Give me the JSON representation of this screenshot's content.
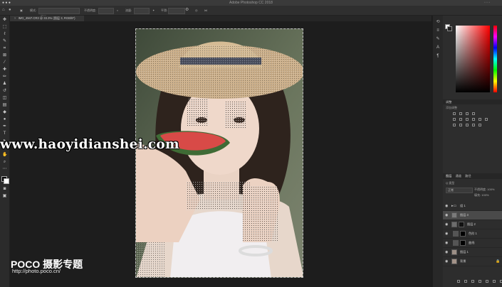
{
  "app": {
    "title": "Adobe Photoshop CC 2018",
    "document_tab": "IMG_4947.CR3 @ 33.3% (图层 3, RGB/8*)"
  },
  "options_bar": {
    "mode_label": "模式:",
    "mode_value": "正常",
    "opacity_label": "不透明度:",
    "opacity_value": "100%",
    "flow_label": "流量:",
    "flow_value": "100%",
    "smoothing_label": "平滑:"
  },
  "toolbar": {
    "tools": [
      "move-tool",
      "marquee-tool",
      "lasso-tool",
      "quick-select-tool",
      "crop-tool",
      "eyedropper-tool",
      "healing-brush-tool",
      "brush-tool",
      "clone-stamp-tool",
      "history-brush-tool",
      "eraser-tool",
      "gradient-tool",
      "blur-tool",
      "dodge-tool",
      "pen-tool",
      "type-tool",
      "path-select-tool",
      "rectangle-tool",
      "hand-tool",
      "zoom-tool"
    ]
  },
  "panels": {
    "adjustments_title": "调整",
    "adjustments_subtitle": "添加调整",
    "layers_tabs": [
      "图层",
      "通道",
      "路径"
    ],
    "blend_mode": "正常",
    "opacity_label": "不透明度:",
    "opacity_value": "100%",
    "fill_label": "填充:",
    "fill_value": "100%",
    "kind_label": "Q 类型",
    "layers": [
      {
        "name": "组 1"
      },
      {
        "name": "图层 3"
      },
      {
        "name": "图层 2"
      },
      {
        "name": "色阶 1"
      },
      {
        "name": "曲线"
      },
      {
        "name": "图层 1"
      },
      {
        "name": "背景"
      }
    ]
  },
  "watermarks": {
    "site": "www.haoyidianshei.com",
    "brand": "POCO 摄影专题",
    "url": "http://photo.poco.cn/"
  },
  "colors": {
    "background": "#1b1b1b",
    "panel": "#2d2d2d",
    "hue_top": "#ff0000"
  }
}
